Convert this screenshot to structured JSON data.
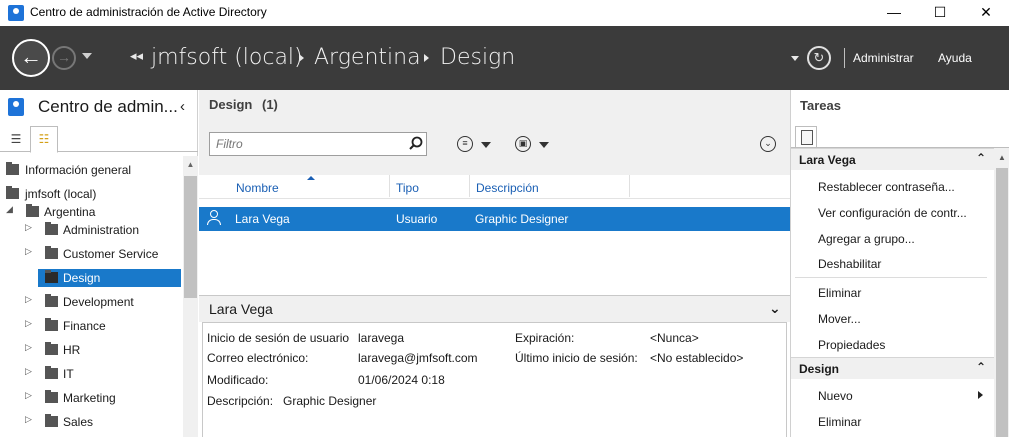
{
  "window": {
    "title": "Centro de administración de Active Directory",
    "minimize_glyph": "—",
    "maximize_glyph": "☐",
    "close_glyph": "✕"
  },
  "header": {
    "back_glyph": "←",
    "forward_glyph": "→",
    "breadcrumb_back_glyph": "◂◂",
    "breadcrumb": [
      "jmfsoft (local)",
      "Argentina",
      "Design"
    ],
    "refresh_glyph": "↻",
    "manage_label": "Administrar",
    "help_label": "Ayuda"
  },
  "nav": {
    "title": "Centro de admin...",
    "collapse_glyph": "‹",
    "list_view_glyph": "☰",
    "tree_view_glyph": "☷",
    "scroll_up_glyph": "▲",
    "items": [
      {
        "label": "Información general",
        "twisty": ""
      },
      {
        "label": "jmfsoft (local)",
        "twisty": ""
      },
      {
        "label": "Argentina",
        "twisty": "◢"
      },
      {
        "label": "Administration",
        "twisty": "▷"
      },
      {
        "label": "Customer Service",
        "twisty": "▷"
      },
      {
        "label": "Design",
        "twisty": ""
      },
      {
        "label": "Development",
        "twisty": "▷"
      },
      {
        "label": "Finance",
        "twisty": "▷"
      },
      {
        "label": "HR",
        "twisty": "▷"
      },
      {
        "label": "IT",
        "twisty": "▷"
      },
      {
        "label": "Marketing",
        "twisty": "▷"
      },
      {
        "label": "Sales",
        "twisty": "▷"
      }
    ]
  },
  "main": {
    "title": "Design",
    "count": "(1)",
    "filter_placeholder": "Filtro",
    "search_glyph": "⚲",
    "query_glyph": "≡",
    "save_glyph": "▣",
    "expand_glyph": "⌄",
    "columns": [
      "Nombre",
      "Tipo",
      "Descripción"
    ],
    "rows": [
      {
        "name": "Lara Vega",
        "type": "Usuario",
        "description": "Graphic Designer"
      }
    ]
  },
  "preview": {
    "title": "Lara Vega",
    "toggle_glyph": "⌄",
    "logon_label": "Inicio de sesión de usuario",
    "logon_value": "laravega",
    "email_label": "Correo electrónico:",
    "email_value": "laravega@jmfsoft.com",
    "modified_label": "Modificado:",
    "modified_value": "01/06/2024 0:18",
    "description_label": "Descripción:",
    "description_value": "Graphic Designer",
    "expiration_label": "Expiración:",
    "expiration_value": "<Nunca>",
    "last_logon_label": "Último inicio de sesión:",
    "last_logon_value": "<No establecido>"
  },
  "tasks": {
    "title": "Tareas",
    "caret_glyph": "⌃",
    "scroll_up_glyph": "▲",
    "sections": [
      {
        "title": "Lara Vega",
        "items": [
          "Restablecer contraseña...",
          "Ver configuración de contr...",
          "Agregar a grupo...",
          "Deshabilitar",
          "Eliminar",
          "Mover...",
          "Propiedades"
        ]
      },
      {
        "title": "Design",
        "items": [
          "Nuevo",
          "Eliminar"
        ]
      }
    ]
  }
}
